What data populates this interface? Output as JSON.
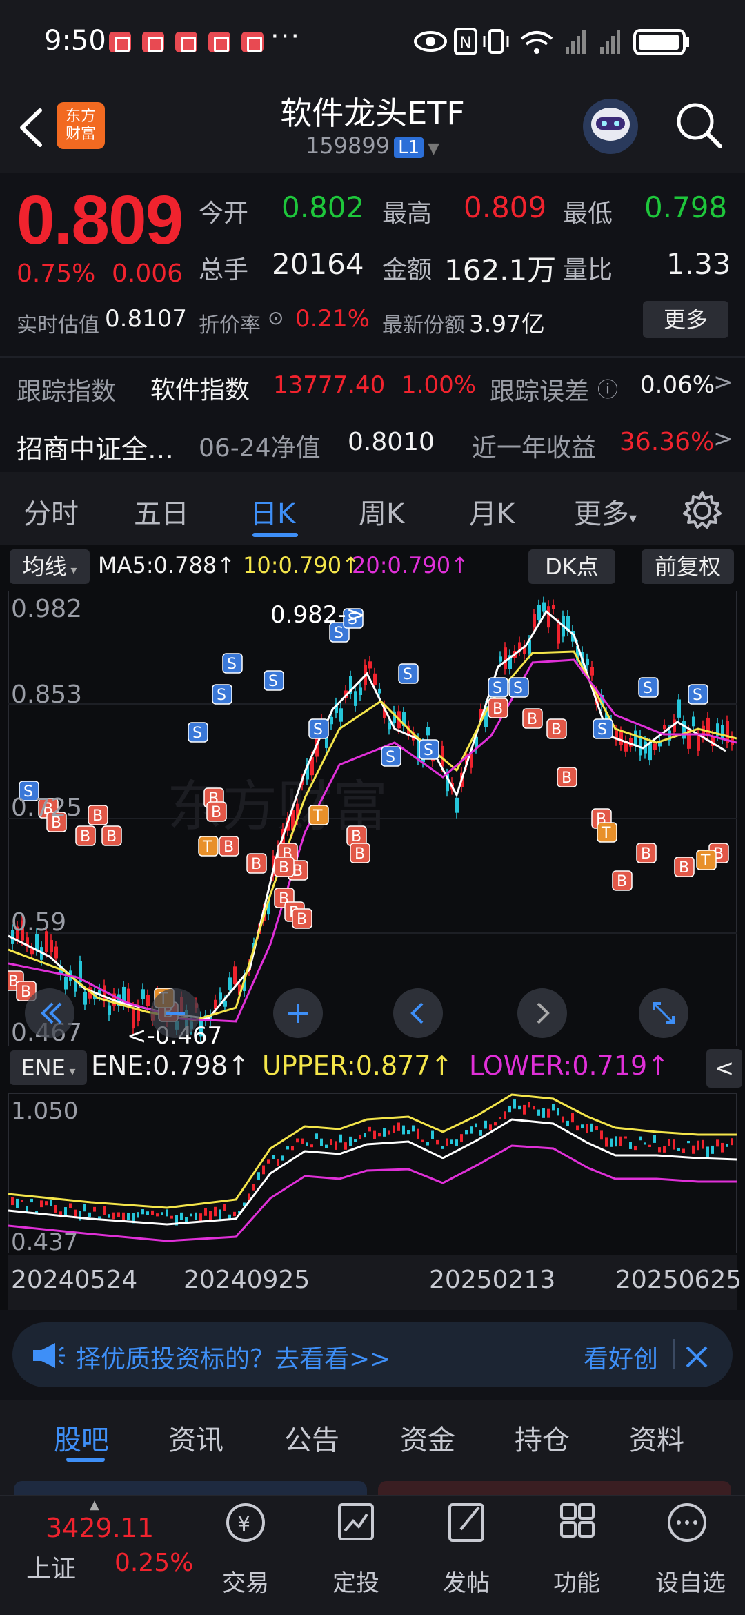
{
  "status_bar": {
    "time": "9:50",
    "more": "···"
  },
  "header": {
    "title": "软件龙头ETF",
    "code": "159899",
    "level_badge": "L1",
    "logo_text_line1": "东方",
    "logo_text_line2": "财富"
  },
  "quote": {
    "price": "0.809",
    "change_pct": "0.75%",
    "change_amt": "0.006",
    "open_label": "今开",
    "open_value": "0.802",
    "high_label": "最高",
    "high_value": "0.809",
    "low_label": "最低",
    "low_value": "0.798",
    "volume_label": "总手",
    "volume_value": "20164",
    "amount_label": "金额",
    "amount_value": "162.1万",
    "ratio_label": "量比",
    "ratio_value": "1.33",
    "iopv_label": "实时估值",
    "iopv_value": "0.8107",
    "premium_label": "折价率",
    "premium_value": "0.21%",
    "shares_label": "最新份额",
    "shares_value": "3.97亿",
    "more_button": "更多"
  },
  "tracking": {
    "index_label": "跟踪指数",
    "index_name": "软件指数",
    "index_value": "13777.40",
    "index_change": "1.00%",
    "error_label": "跟踪误差",
    "error_value": "0.06%",
    "fund_name": "招商中证全…",
    "nav_label": "06-24净值",
    "nav_value": "0.8010",
    "year_label": "近一年收益",
    "year_value": "36.36%"
  },
  "kline_tabs": [
    "分时",
    "五日",
    "日K",
    "周K",
    "月K",
    "更多"
  ],
  "active_tab": "日K",
  "ma_bar": {
    "selector": "均线",
    "ma5": "MA5:0.788↑",
    "ma10": "10:0.790↑",
    "ma20": "20:0.790↑",
    "dk_button": "DK点",
    "adjust_button": "前复权"
  },
  "main_chart": {
    "y_labels": [
      "0.982",
      "0.853",
      "0.725",
      "0.59",
      "0.467"
    ],
    "high_marker": "0.982->",
    "low_marker": "<-0.467"
  },
  "ene_bar": {
    "selector": "ENE",
    "ene": "ENE:0.798↑",
    "upper": "UPPER:0.877↑",
    "lower": "LOWER:0.719↑"
  },
  "ene_chart": {
    "y_labels": [
      "1.050",
      "0.437"
    ]
  },
  "x_axis": [
    "20240524",
    "20240925",
    "20250213",
    "20250625"
  ],
  "banner": {
    "text": "择优质投资标的？去看看>>",
    "right_text": "看好创"
  },
  "bottom_tabs": [
    "股吧",
    "资讯",
    "公告",
    "资金",
    "持仓",
    "资料"
  ],
  "active_bottom_tab": "股吧",
  "bottom_nav": {
    "index_value": "3429.11",
    "index_name": "上证",
    "index_change": "0.25%",
    "items": [
      "交易",
      "定投",
      "发帖",
      "功能",
      "设自选"
    ]
  },
  "colors": {
    "up": "#f0232e",
    "down": "#1ec63b",
    "accent": "#3e8ff7",
    "ma5": "#ffffff",
    "ma10": "#f4e54a",
    "ma20": "#e030d8"
  }
}
